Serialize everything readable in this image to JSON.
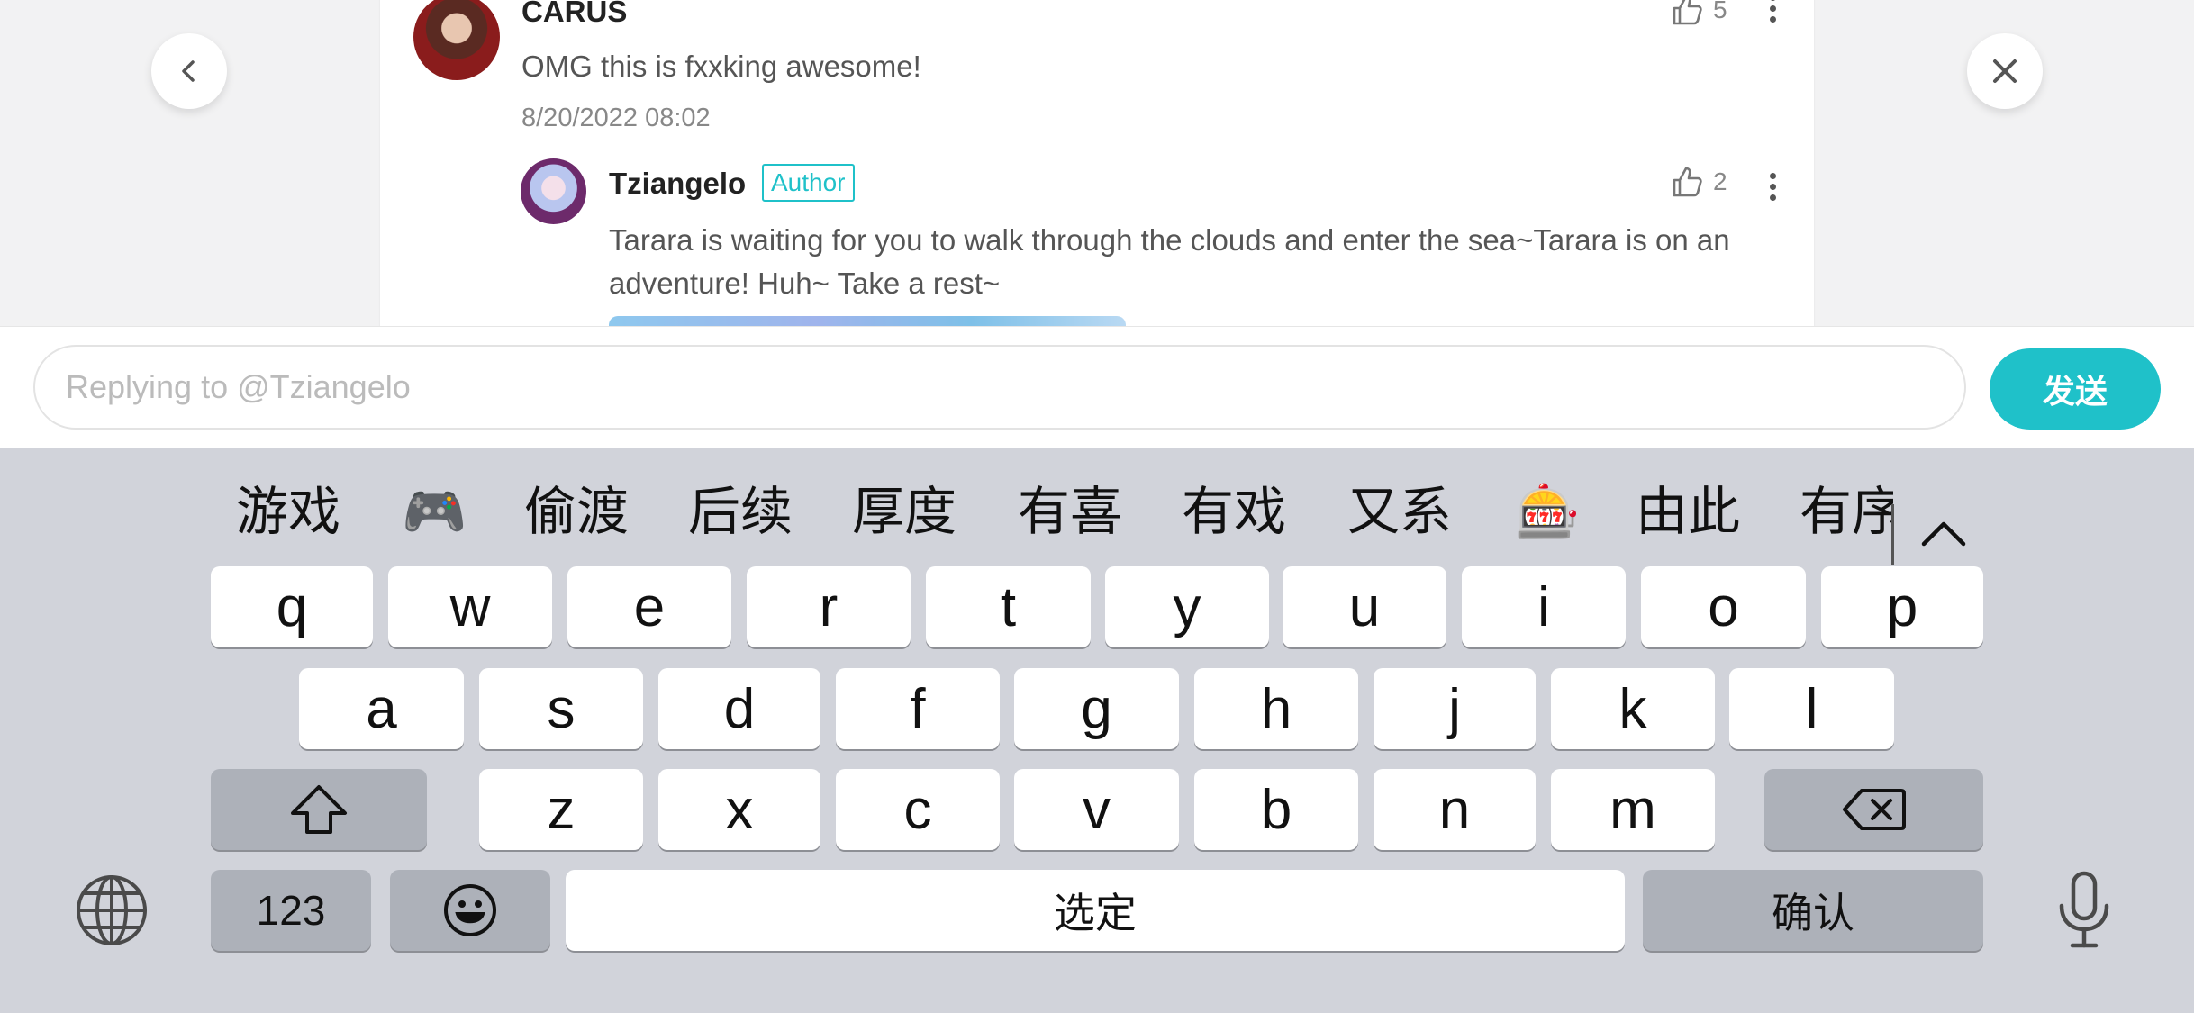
{
  "comments": {
    "parent": {
      "username": "CARUS",
      "text": "OMG this is fxxking awesome!",
      "date": "8/20/2022",
      "time": "08:02",
      "likes": "5"
    },
    "reply": {
      "username": "Tziangelo",
      "badge": "Author",
      "text": "Tarara is waiting for you to walk through the clouds and enter the sea~Tarara is on an adventure! Huh~ Take a rest~",
      "likes": "2"
    }
  },
  "reply_bar": {
    "placeholder": "Replying to @Tziangelo",
    "send_label": "发送"
  },
  "keyboard": {
    "candidates": [
      "游戏",
      "🎮",
      "偷渡",
      "后续",
      "厚度",
      "有喜",
      "有戏",
      "又系",
      "🎰",
      "由此",
      "有序"
    ],
    "row1": [
      "q",
      "w",
      "e",
      "r",
      "t",
      "y",
      "u",
      "i",
      "o",
      "p"
    ],
    "row2": [
      "a",
      "s",
      "d",
      "f",
      "g",
      "h",
      "j",
      "k",
      "l"
    ],
    "row3": [
      "z",
      "x",
      "c",
      "v",
      "b",
      "n",
      "m"
    ],
    "numbers_label": "123",
    "space_label": "选定",
    "confirm_label": "确认"
  },
  "colors": {
    "accent": "#1fc1c9",
    "keyboard_bg": "#d1d3da"
  },
  "icons": [
    "back-chevron-icon",
    "close-icon",
    "thumbs-up-icon",
    "more-icon",
    "shift-icon",
    "backspace-icon",
    "globe-icon",
    "emoji-icon",
    "microphone-icon",
    "chevron-up-icon"
  ]
}
